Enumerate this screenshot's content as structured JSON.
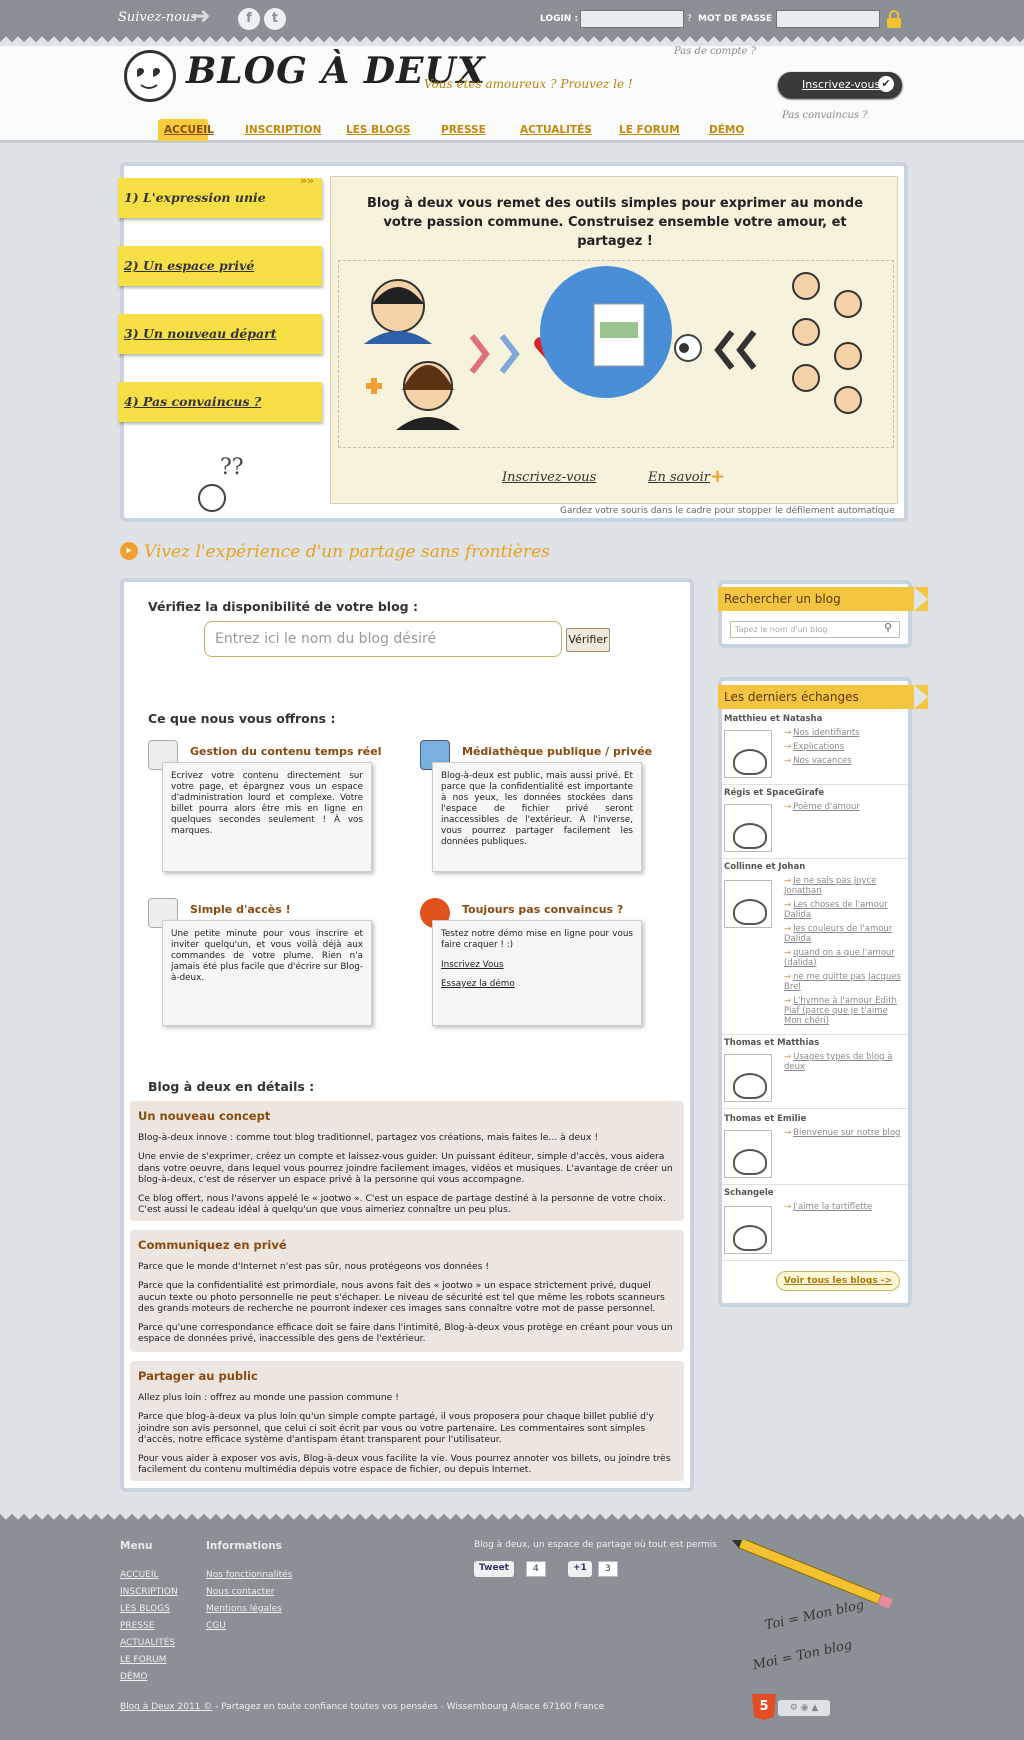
{
  "topbar": {
    "follow": "Suivez-nous",
    "facebook_icon": "f",
    "twitter_icon": "t",
    "login_label": "LOGIN :",
    "login_sep": "?",
    "password_label": "MOT DE PASSE :"
  },
  "header": {
    "logo_text": "BLOG À DEUX",
    "tagline": "Vous êtes amoureux ? Prouvez le !",
    "no_account": "Pas de compte ?",
    "signup_button": "Inscrivez-vous",
    "not_convinced": "Pas convaincus ?"
  },
  "nav": [
    "ACCUEIL",
    "INSCRIPTION",
    "LES BLOGS",
    "PRESSE",
    "ACTUALITÉS",
    "LE FORUM",
    "DÉMO"
  ],
  "hero": {
    "stickies": [
      "1) L'expression unie",
      "2) Un espace privé",
      "3) Un nouveau départ",
      "4) Pas convaincus ?"
    ],
    "text": "Blog à deux vous remet des outils simples pour exprimer au monde votre passion commune. Construisez ensemble votre amour, et partagez !",
    "link_signup": "Inscrivez-vous",
    "link_more": "En savoir",
    "auto_scroll": "Gardez votre souris dans le cadre pour stopper le défilement automatique"
  },
  "experience_title": "Vivez l'expérience d'un partage sans frontières",
  "main": {
    "check_title": "Vérifiez la disponibilité de votre blog :",
    "blog_placeholder": "Entrez ici le nom du blog désiré",
    "verify_button": "Vérifier",
    "offer_title": "Ce que nous vous offrons :",
    "features": [
      {
        "title": "Gestion du contenu temps réel",
        "text": "Ecrivez votre contenu directement sur votre page, et épargnez vous un espace d'administration lourd et complexe. Votre billet pourra alors être mis en ligne en quelques secondes seulement ! À vos marques."
      },
      {
        "title": "Médiathèque publique / privée",
        "text": "Blog-à-deux est public, mais aussi privé. Et parce que la confidentialité est importante à nos yeux, les données stockées dans l'espace de fichier privé seront inaccessibles de l'extérieur. À l'inverse, vous pourrez partager facilement les données publiques."
      },
      {
        "title": "Simple d'accès !",
        "text": "Une petite minute pour vous inscrire et inviter quelqu'un, et vous voilà déjà aux commandes de votre plume. Rien n'a jamais été plus facile que d'écrire sur Blog-à-deux."
      },
      {
        "title": "Toujours pas convaincus ?",
        "text": "Testez notre démo mise en ligne pour vous faire craquer ! :)",
        "link1": "Inscrivez Vous",
        "link2": "Essayez la démo"
      }
    ],
    "details_title": "Blog à deux en détails :",
    "details": [
      {
        "title": "Un nouveau concept",
        "paras": [
          "Blog-à-deux innove : comme tout blog traditionnel, partagez vos créations, mais faites le... à deux !",
          "Une envie de s'exprimer, créez un compte et laissez-vous guider. Un puissant éditeur, simple d'accès, vous aidera dans votre oeuvre, dans lequel vous pourrez joindre facilement images, vidéos et musiques. L'avantage de créer un blog-à-deux, c'est de réserver un espace privé à la personne qui vous accompagne.",
          "Ce blog offert, nous l'avons appelé le « jootwo ». C'est un espace de partage destiné à la personne de votre choix. C'est aussi le cadeau idéal à quelqu'un que vous aimeriez connaître un peu plus."
        ]
      },
      {
        "title": "Communiquez en privé",
        "paras": [
          "Parce que le monde d'Internet n'est pas sûr, nous protégeons vos données !",
          "Parce que la confidentialité est primordiale, nous avons fait des « jootwo » un espace strictement privé, duquel aucun texte ou photo personnelle ne peut s'échaper. Le niveau de sécurité est tel que même les robots scanneurs des grands moteurs de recherche ne pourront indexer ces images sans connaître votre mot de passe personnel.",
          "Parce qu'une correspondance efficace doit se faire dans l'intimité, Blog-à-deux vous protège en créant pour vous un espace de données privé, inaccessible des gens de l'extérieur."
        ]
      },
      {
        "title": "Partager au public",
        "paras": [
          "Allez plus loin : offrez au monde une passion commune !",
          "Parce que blog-à-deux va plus loin qu'un simple compte partagé, il vous proposera pour chaque billet publié d'y joindre son avis personnel, que celui ci soit écrit par vous ou votre partenaire. Les commentaires sont simples d'accès, notre efficace système d'antispam étant transparent pour l'utilisateur.",
          "Pour vous aider à exposer vos avis, Blog-à-deux vous facilite la vie. Vous pourrez annoter vos billets, ou joindre très facilement du contenu multimédia depuis votre espace de fichier, ou depuis Internet."
        ]
      }
    ]
  },
  "sidebar": {
    "search_title": "Rechercher un blog",
    "search_placeholder": "Tapez le nom d'un blog",
    "latest_title": "Les derniers échanges",
    "exchanges": [
      {
        "names": "Matthieu et Natasha",
        "links": [
          "Nos identifiants",
          "Explications",
          "Nos vacances"
        ]
      },
      {
        "names": "Régis et SpaceGirafe",
        "links": [
          "Poème d'amour"
        ]
      },
      {
        "names": "Collinne et Johan",
        "links": [
          "Je ne sais pas Joyce Jonathan",
          "Les choses de l'amour Dalida",
          "les couleurs de l'amour Dalida",
          "quand on a que l'amour (dalida)",
          "ne me quitte pas Jacques Brel",
          "L'hymne à l'amour Edith Piaf (parce que je t'aime Mon chéri)"
        ]
      },
      {
        "names": "Thomas et Matthias",
        "links": [
          "Usages types de blog à deux"
        ]
      },
      {
        "names": "Thomas et Emilie",
        "links": [
          "Bienvenue sur notre blog"
        ]
      },
      {
        "names": "Schangele",
        "links": [
          "J'aime la tartiflette"
        ]
      }
    ],
    "see_all": "Voir tous les blogs ->"
  },
  "footer": {
    "menu_title": "Menu",
    "menu": [
      "ACCUEIL",
      "INSCRIPTION",
      "LES BLOGS",
      "PRESSE",
      "ACTUALITÉS",
      "LE FORUM",
      "DÉMO"
    ],
    "info_title": "Informations",
    "info": [
      "Nos fonctionnalités",
      "Nous contacter",
      "Mentions légales",
      "CGU"
    ],
    "tagline": "Blog à deux, un espace de partage où tout est permis",
    "tweet": "Tweet",
    "tweet_count": "4",
    "plusone": "+1",
    "plusone_count": "3",
    "toi": "Toi = Mon blog",
    "moi": "Moi = Ton blog",
    "copyright_link": "Blog à Deux 2011 ©",
    "copyright": " - Partagez en toute confiance toutes vos pensées - Wissembourg Alsace 67160 France",
    "html5": "5"
  }
}
